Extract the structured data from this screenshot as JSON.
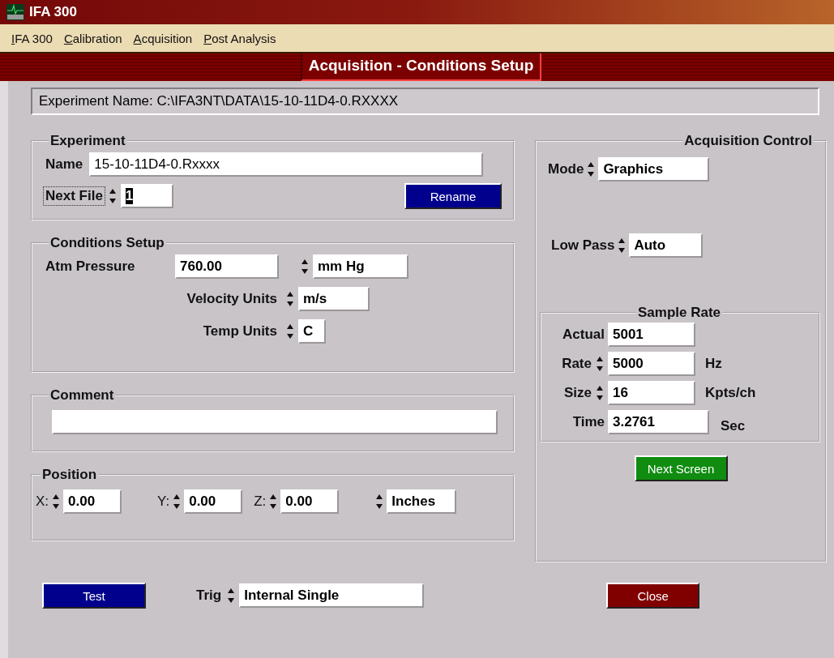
{
  "window": {
    "title": "IFA 300"
  },
  "menu": [
    {
      "label": "IFA 300"
    },
    {
      "label": "Calibration"
    },
    {
      "label": "Acquisition"
    },
    {
      "label": "Post Analysis"
    }
  ],
  "screen_title": "Acquisition - Conditions Setup",
  "experiment_name": "Experiment Name: C:\\IFA3NT\\DATA\\15-10-11D4-0.RXXXX",
  "experiment": {
    "title": "Experiment",
    "name": {
      "label": "Name",
      "value": "15-10-11D4-0.Rxxxx"
    },
    "next_file": {
      "label": "Next File",
      "value": "1",
      "kind": "spinner",
      "focused": true
    },
    "rename_button": "Rename"
  },
  "conditions": {
    "title": "Conditions Setup",
    "fields": [
      {
        "label": "Atm Pressure",
        "value": "760.00",
        "kind": "plain",
        "unit_value": "mm Hg"
      },
      {
        "label": "Velocity Units",
        "value": "m/s",
        "kind": "spinner"
      },
      {
        "label": "Temp Units",
        "value": "C",
        "kind": "spinner"
      }
    ]
  },
  "comment": {
    "title": "Comment"
  },
  "position": {
    "title": "Position",
    "fields": [
      {
        "label": "X:",
        "value": "0.00",
        "kind": "spinner"
      },
      {
        "label": "Y:",
        "value": "0.00",
        "kind": "spinner"
      },
      {
        "label": "Z:",
        "value": "0.00",
        "kind": "spinner"
      },
      {
        "value": "Inches",
        "kind": "spinner"
      }
    ]
  },
  "acquisition_control": {
    "title": "Acquisition Control",
    "fields": [
      {
        "label": "Mode",
        "value": "Graphics",
        "kind": "spinner"
      },
      {
        "label": "Low Pass",
        "value": "Auto",
        "kind": "spinner"
      }
    ],
    "sample_rate": {
      "title": "Sample Rate",
      "fields": [
        {
          "label": "Actual",
          "value": "5001",
          "kind": "plain"
        },
        {
          "label": "Rate",
          "value": "5000",
          "kind": "spinner",
          "unit": "Hz"
        },
        {
          "label": "Size",
          "value": "16",
          "kind": "spinner",
          "unit": "Kpts/ch"
        },
        {
          "label": "Time",
          "value": "3.2761",
          "kind": "plain",
          "unit": "Sec"
        }
      ]
    },
    "next_button": "Next Screen"
  },
  "test_button": "Test",
  "trigger": {
    "label": "Trig",
    "value": "Internal Single",
    "kind": "spinner"
  },
  "close_button": "Close"
}
